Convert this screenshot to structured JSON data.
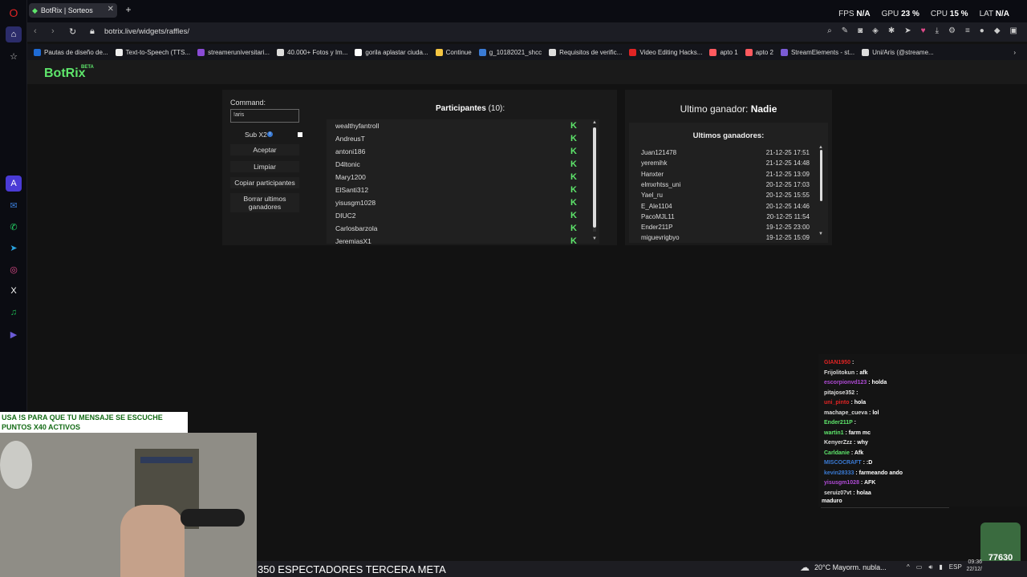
{
  "browser": {
    "tab_title": "BotRix | Sorteos",
    "url": "botrix.live/widgets/raffles/",
    "stats": {
      "fps_label": "FPS",
      "fps_value": "N/A",
      "gpu_label": "GPU",
      "gpu_value": "23 %",
      "cpu_label": "CPU",
      "cpu_value": "15 %",
      "lat_label": "LAT",
      "lat_value": "N/A"
    },
    "bookmarks": [
      {
        "label": "Pautas de diseño de...",
        "color": "#1e6bd6"
      },
      {
        "label": "Text-to-Speech (TTS...",
        "color": "#eeeeee"
      },
      {
        "label": "streameruniversitari...",
        "color": "#8a4bd6"
      },
      {
        "label": "40.000+ Fotos y Im...",
        "color": "#dddddd"
      },
      {
        "label": "gorila aplastar ciuda...",
        "color": "#ffffff"
      },
      {
        "label": "Continue",
        "color": "#f4c542"
      },
      {
        "label": "g_10182021_shcc",
        "color": "#3a7bd5"
      },
      {
        "label": "Requisitos de verific...",
        "color": "#dddddd"
      },
      {
        "label": "Video Editing Hacks...",
        "color": "#e02424"
      },
      {
        "label": "apto 1",
        "color": "#ff5a5f"
      },
      {
        "label": "apto 2",
        "color": "#ff5a5f"
      },
      {
        "label": "StreamElements - st...",
        "color": "#7b5cd6"
      },
      {
        "label": "Uni/Aris (@streame...",
        "color": "#dddddd"
      }
    ]
  },
  "app": {
    "brand": "BotRix",
    "brand_badge": "BETA",
    "command_label": "Command:",
    "command_value": "!aris",
    "sub_label": "Sub X2",
    "buttons": {
      "accept": "Aceptar",
      "clear": "Limpiar",
      "copy": "Copiar participantes",
      "delete": "Borrar ultimos ganadores"
    },
    "participants_label": "Participantes",
    "participants_count": "(10):",
    "participants": [
      "wealthyfantroll",
      "AndreusT",
      "antoni186",
      "D4ltonic",
      "Mary1200",
      "ElSanti312",
      "yisusgm1028",
      "DIUC2",
      "Carlosbarzola",
      "JeremiasX1"
    ],
    "last_winner_label": "Ultimo ganador:",
    "last_winner_value": "Nadie",
    "winners_title": "Ultimos ganadores:",
    "winners": [
      {
        "name": "Juan121478",
        "date": "21-12-25 17:51"
      },
      {
        "name": "yeremihk",
        "date": "21-12-25 14:48"
      },
      {
        "name": "Hanxter",
        "date": "21-12-25 13:09"
      },
      {
        "name": "elmxrhtss_uni",
        "date": "20-12-25 17:03"
      },
      {
        "name": "Yael_ru",
        "date": "20-12-25 15:55"
      },
      {
        "name": "E_Ale1104",
        "date": "20-12-25 14:46"
      },
      {
        "name": "PacoMJL11",
        "date": "20-12-25 11:54"
      },
      {
        "name": "Ender211P",
        "date": "19-12-25 23:00"
      },
      {
        "name": "miguevrigbyo",
        "date": "19-12-25 15:09"
      }
    ]
  },
  "stream": {
    "promo_line1": "USA !S PARA QUE TU MENSAJE SE ESCUCHE",
    "promo_line2": "PUNTOS X40 ACTIVOS",
    "ticker": "350 ESPECTADORES TERCERA META",
    "emote_badge": "77630",
    "chat": [
      {
        "user": "GIAN1950",
        "msg": "",
        "color": "#e02424"
      },
      {
        "user": "Frijolitokun",
        "msg": "afk",
        "color": "#dddddd"
      },
      {
        "user": "escorpionvd123",
        "msg": "holda",
        "color": "#b04bd6"
      },
      {
        "user": "pitajose352",
        "msg": "",
        "color": "#dddddd"
      },
      {
        "user": "uni_pinto",
        "msg": "hola",
        "color": "#e02424"
      },
      {
        "user": "machape_cueva",
        "msg": "lol",
        "color": "#dddddd"
      },
      {
        "user": "Ender211P",
        "msg": "",
        "color": "#5ee66b"
      },
      {
        "user": "wartin1",
        "msg": "farm mc",
        "color": "#5ee66b"
      },
      {
        "user": "KenyerZzz",
        "msg": "why",
        "color": "#dddddd"
      },
      {
        "user": "Carldanie",
        "msg": "Afk",
        "color": "#5ee66b"
      },
      {
        "user": "MISCOCRAFT",
        "msg": ":D",
        "color": "#3a7bd5"
      },
      {
        "user": "kevin28333",
        "msg": "farmeando ando",
        "color": "#3a7bd5"
      },
      {
        "user": "yisusgm1028",
        "msg": "AFK",
        "color": "#b04bd6"
      },
      {
        "user": "seruiz07vt",
        "msg": "holaa",
        "color": "#dddddd"
      }
    ],
    "chat_input": "maduro"
  },
  "taskbar": {
    "weather": "20°C  Mayorm. nubla...",
    "lang": "ESP",
    "time": "09:36",
    "date": "22/12/"
  }
}
